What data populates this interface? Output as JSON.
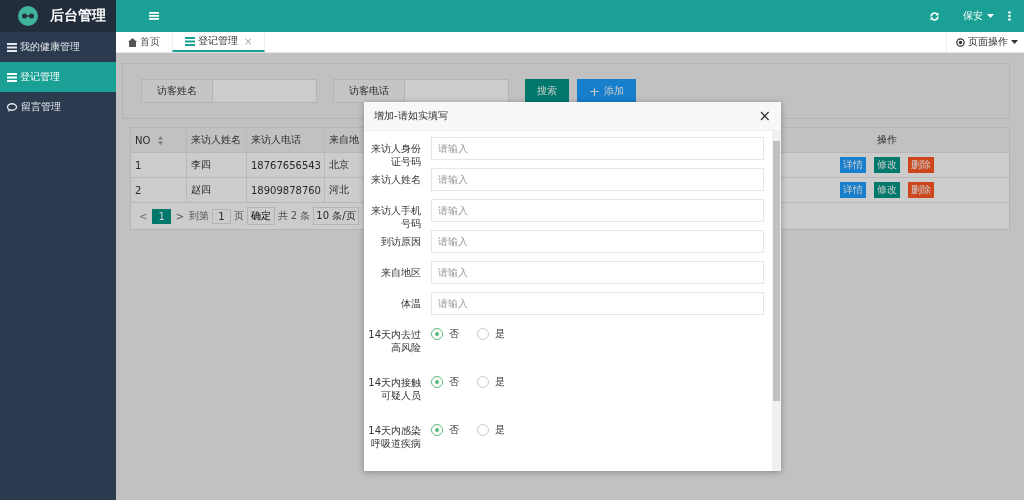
{
  "app": {
    "title": "后台管理"
  },
  "header": {
    "user": "保安"
  },
  "sidebar": {
    "items": [
      {
        "label": "我的健康管理",
        "kind": "list",
        "selected": false
      },
      {
        "label": "登记管理",
        "kind": "list",
        "selected": true
      },
      {
        "label": "留言管理",
        "kind": "chat",
        "selected": false
      }
    ]
  },
  "tabs": [
    {
      "label": "首页",
      "kind": "home",
      "selected": false
    },
    {
      "label": "登记管理",
      "kind": "list",
      "selected": true,
      "close": "×"
    }
  ],
  "page_actions": "页面操作",
  "search": {
    "fields": [
      {
        "label": "访客姓名"
      },
      {
        "label": "访客电话"
      }
    ],
    "buttons": [
      {
        "label": "搜索",
        "kind": "search"
      },
      {
        "label": "添加",
        "kind": "add"
      }
    ],
    "add_icon": "+"
  },
  "table": {
    "columns": [
      "NO",
      "来访人姓名",
      "来访人电话",
      "来自地",
      "操作"
    ],
    "rows": [
      {
        "no": "1",
        "name": "李四",
        "phone": "18767656543",
        "region": "北京",
        "actions": [
          "详情",
          "修改",
          "删除"
        ]
      },
      {
        "no": "2",
        "name": "赵四",
        "phone": "18909878760",
        "region": "河北",
        "actions": [
          "详情",
          "修改",
          "删除"
        ]
      }
    ]
  },
  "pagination": {
    "prev": "<",
    "pages": [
      {
        "label": "1",
        "selected": true
      }
    ],
    "next": ">",
    "goto_label": "到第",
    "goto_value": "1",
    "page_unit": "页",
    "confirm": "确定",
    "total": "共 2 条",
    "page_size": "10 条/页"
  },
  "modal": {
    "title": "增加-请如实填写",
    "close": "×",
    "fields": [
      {
        "kind": "text",
        "label": "来访人身份证号码",
        "placeholder": "请输入"
      },
      {
        "kind": "text",
        "label": "来访人姓名",
        "placeholder": "请输入"
      },
      {
        "kind": "text",
        "label": "来访人手机号码",
        "placeholder": "请输入"
      },
      {
        "kind": "text",
        "label": "到访原因",
        "placeholder": "请输入"
      },
      {
        "kind": "text",
        "label": "来自地区",
        "placeholder": "请输入"
      },
      {
        "kind": "text",
        "label": "体温",
        "placeholder": "请输入"
      },
      {
        "kind": "radio",
        "label": "14天内去过高风险",
        "options": [
          {
            "label": "否",
            "selected": true
          },
          {
            "label": "是",
            "selected": false
          }
        ]
      },
      {
        "kind": "radio",
        "label": "14天内接触可疑人员",
        "options": [
          {
            "label": "否",
            "selected": true
          },
          {
            "label": "是",
            "selected": false
          }
        ]
      },
      {
        "kind": "radio",
        "label": "14天内感染呼吸道疾病",
        "options": [
          {
            "label": "否",
            "selected": true
          },
          {
            "label": "是",
            "selected": false
          }
        ]
      }
    ]
  }
}
